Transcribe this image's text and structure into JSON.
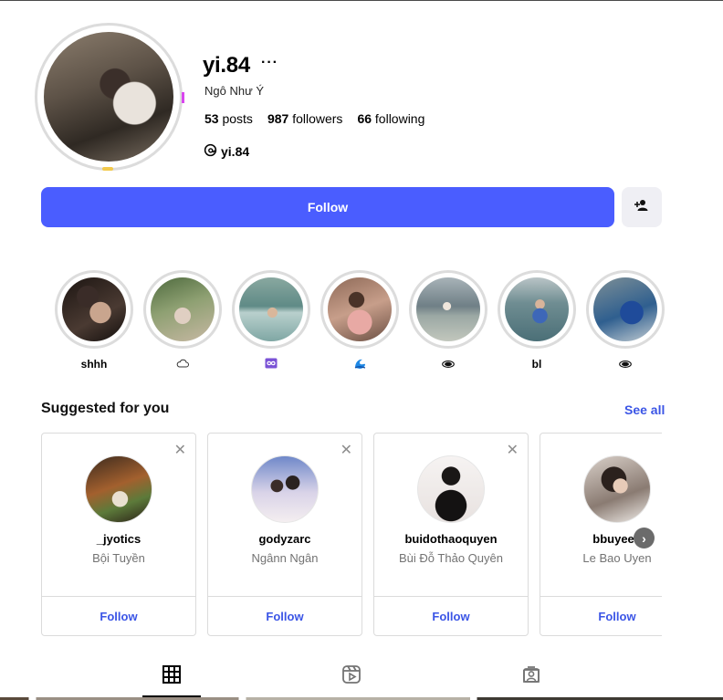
{
  "profile": {
    "username": "yi.84",
    "more": "···",
    "full_name": "Ngô Như Ý",
    "posts_count": "53",
    "posts_label": "posts",
    "followers_count": "987",
    "followers_label": "followers",
    "following_count": "66",
    "following_label": "following",
    "threads_handle": "yi.84",
    "follow_label": "Follow",
    "add_user_icon": "add-person-icon"
  },
  "highlights": [
    {
      "label": "shhh",
      "icon": ""
    },
    {
      "label": "",
      "icon": "cloud"
    },
    {
      "label": "",
      "icon": "infinity-badge"
    },
    {
      "label": "",
      "icon": "wave"
    },
    {
      "label": "",
      "icon": "eye"
    },
    {
      "label": "bl",
      "icon": ""
    },
    {
      "label": "",
      "icon": "eye"
    }
  ],
  "suggested": {
    "title": "Suggested for you",
    "see_all": "See all",
    "cards": [
      {
        "username": "_jyotics",
        "name": "Bội Tuyền",
        "follow": "Follow"
      },
      {
        "username": "godyzarc",
        "name": "Ngânn Ngân",
        "follow": "Follow"
      },
      {
        "username": "buidothaoquyen",
        "name": "Bùi Đỗ Thảo Quyên",
        "follow": "Follow"
      },
      {
        "username": "bbuyeen",
        "name": "Le Bao Uyen",
        "follow": "Follow"
      }
    ]
  },
  "tabs": [
    {
      "name": "posts",
      "icon": "grid-icon",
      "active": true
    },
    {
      "name": "reels",
      "icon": "reels-icon",
      "active": false
    },
    {
      "name": "tagged",
      "icon": "tagged-icon",
      "active": false
    }
  ],
  "colors": {
    "accent": "#4a5dff",
    "link": "#3b55e6"
  }
}
